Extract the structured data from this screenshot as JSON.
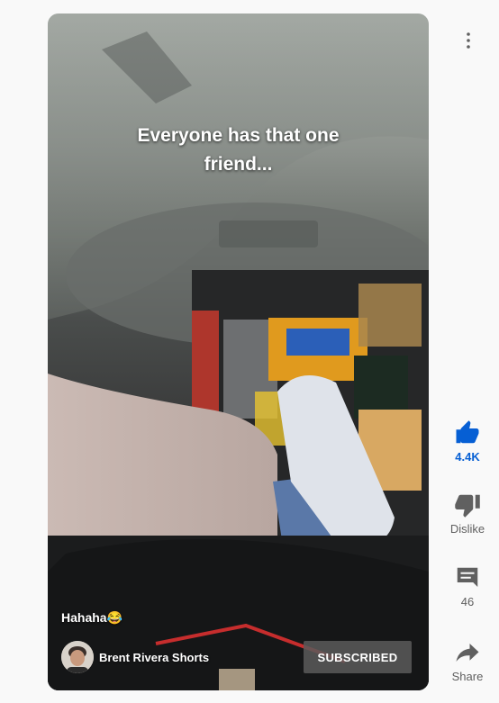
{
  "video": {
    "caption_lines": [
      "Everyone has that one",
      "friend..."
    ],
    "description": "Hahaha😂",
    "channel_name": "Brent Rivera Shorts",
    "subscribe_label": "SUBSCRIBED"
  },
  "actions": {
    "like_count": "4.4K",
    "dislike_label": "Dislike",
    "comments_count": "46",
    "share_label": "Share"
  },
  "colors": {
    "accent": "#065fd4",
    "icon": "#606060",
    "page_bg": "#f9f9f9"
  },
  "icons": [
    "more-vert-icon",
    "thumbs-up-icon",
    "thumbs-down-icon",
    "comment-icon",
    "share-icon"
  ]
}
